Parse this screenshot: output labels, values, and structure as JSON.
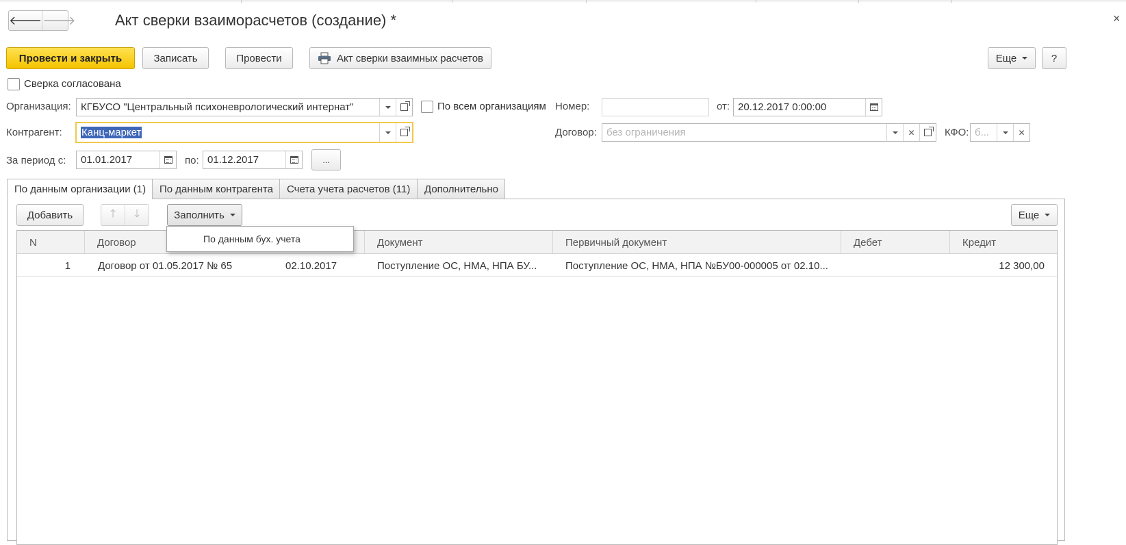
{
  "window": {
    "title": "Акт сверки взаиморасчетов (создание) *",
    "close_glyph": "×"
  },
  "nav": {
    "back_glyph": "🡐",
    "forward_glyph": "🡒"
  },
  "toolbar": {
    "post_and_close": "Провести и закрыть",
    "save": "Записать",
    "post": "Провести",
    "print_act": "Акт сверки взаимных расчетов",
    "more": "Еще",
    "help": "?"
  },
  "form": {
    "agreed_label": "Сверка согласована",
    "org_label": "Организация:",
    "org_value": "КГБУСО \"Центральный психоневрологический интернат\"",
    "all_orgs_label": "По всем организациям",
    "number_label": "Номер:",
    "number_value": "",
    "date_from_label": "от:",
    "date_value": "20.12.2017  0:00:00",
    "counterparty_label": "Контрагент:",
    "counterparty_value": "Канц-маркет",
    "contract_label": "Договор:",
    "contract_placeholder": "без ограничения",
    "kfo_label": "КФО:",
    "kfo_placeholder": "б...",
    "period_label": "За период с:",
    "period_start": "01.01.2017",
    "period_to_label": "по:",
    "period_end": "01.12.2017",
    "period_more": "..."
  },
  "tabs": [
    {
      "label": "По данным организации (1)"
    },
    {
      "label": "По данным контрагента"
    },
    {
      "label": "Счета учета расчетов (11)"
    },
    {
      "label": "Дополнительно"
    }
  ],
  "table_toolbar": {
    "add": "Добавить",
    "up_glyph": "🡑",
    "down_glyph": "🡓",
    "fill": "Заполнить",
    "more": "Еще",
    "dropdown_item": "По данным бух. учета"
  },
  "table": {
    "columns": [
      "N",
      "Договор",
      "Документ",
      "Первичный документ",
      "Дебет",
      "Кредит"
    ],
    "rows": [
      {
        "n": "1",
        "contract": "Договор от 01.05.2017 № 65",
        "date": "02.10.2017",
        "document": "Поступление ОС, НМА, НПА БУ...",
        "primary": "Поступление ОС, НМА, НПА №БУ00-000005 от 02.10...",
        "debit": "",
        "credit": "12 300,00"
      }
    ]
  },
  "colors": {
    "primary_button": "#f5c400",
    "focus_border": "#f2c94c",
    "selection": "#3f67b8"
  }
}
